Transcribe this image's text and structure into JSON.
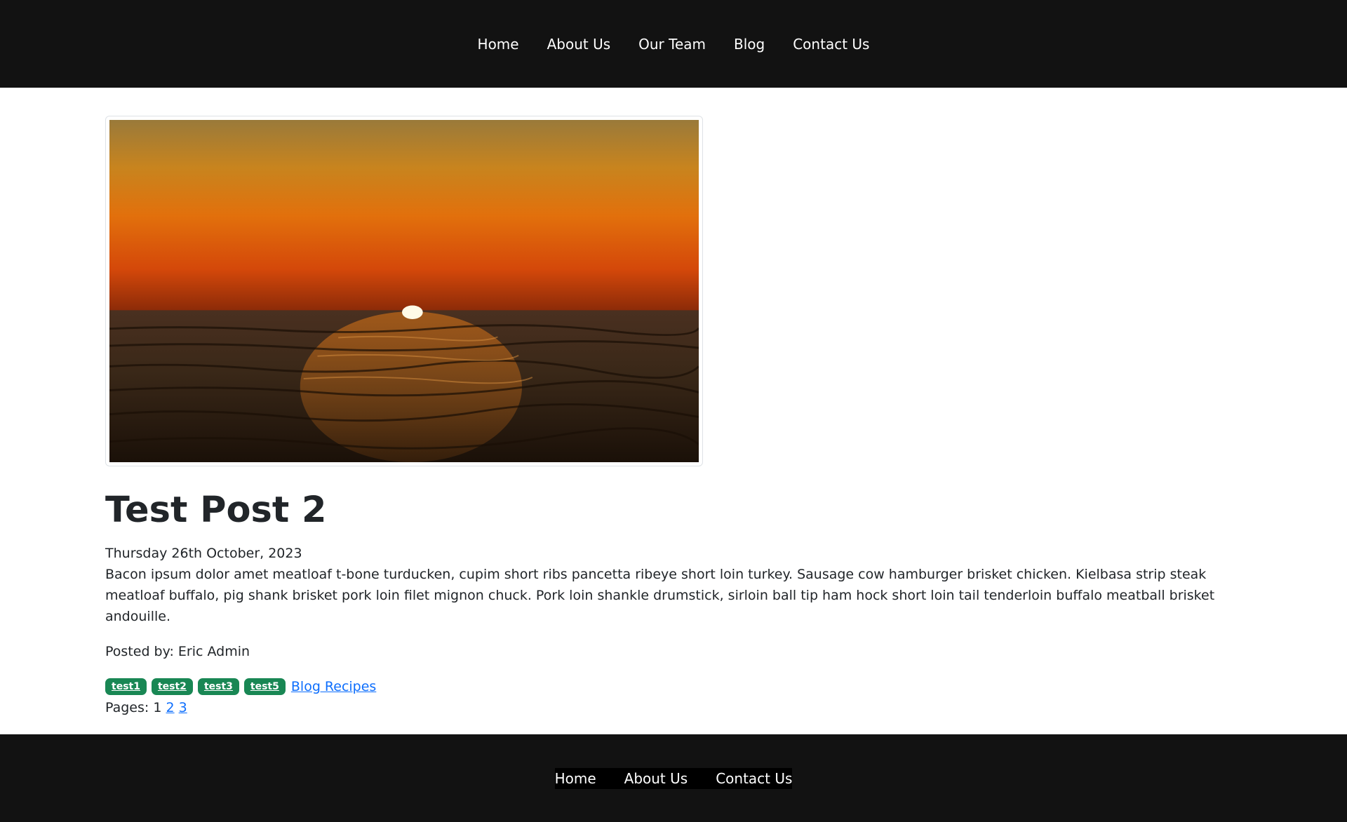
{
  "header": {
    "nav": [
      {
        "label": "Home"
      },
      {
        "label": "About Us"
      },
      {
        "label": "Our Team"
      },
      {
        "label": "Blog"
      },
      {
        "label": "Contact Us"
      }
    ]
  },
  "post": {
    "image_icon": "sunset-over-sea-image",
    "title": "Test Post 2",
    "date": "Thursday 26th October, 2023",
    "body": "Bacon ipsum dolor amet meatloaf t-bone turducken, cupim short ribs pancetta ribeye short loin turkey. Sausage cow hamburger brisket chicken. Kielbasa strip steak meatloaf buffalo, pig shank brisket pork loin filet mignon chuck. Pork loin shankle drumstick, sirloin ball tip ham hock short loin tail tenderloin buffalo meatball brisket andouille.",
    "author": "Posted by: Eric Admin",
    "tags": [
      "test1",
      "test2",
      "test3",
      "test5"
    ],
    "category": "Blog Recipes",
    "pages_label": "Pages:",
    "current_page": "1",
    "page_links": [
      "2",
      "3"
    ]
  },
  "footer": {
    "nav": [
      {
        "label": "Home"
      },
      {
        "label": "About Us"
      },
      {
        "label": "Contact Us"
      }
    ]
  },
  "colors": {
    "header_bg": "#121212",
    "tag_bg": "#198754",
    "link": "#0d6efd"
  }
}
